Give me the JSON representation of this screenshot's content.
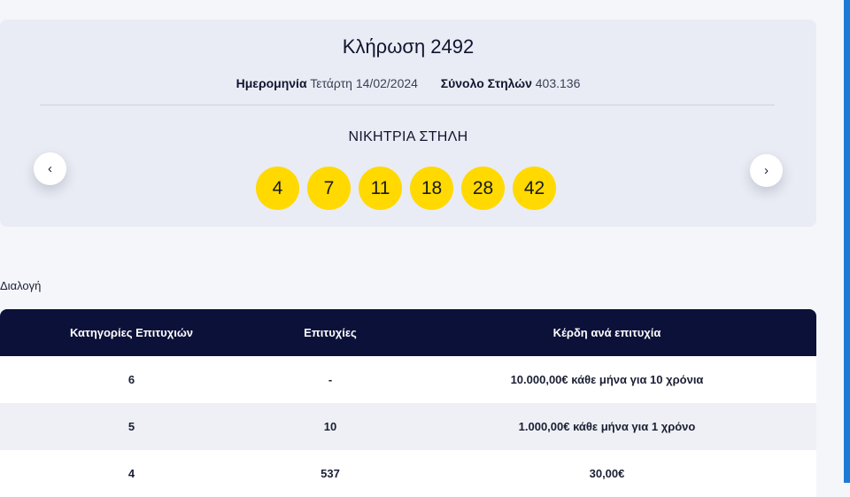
{
  "draw": {
    "title": "Κλήρωση 2492",
    "date_label": "Ημερομηνία",
    "date_value": "Τετάρτη 14/02/2024",
    "total_label": "Σύνολο Στηλών",
    "total_value": "403.136",
    "winning_label": "ΝΙΚΗΤΡΙΑ ΣΤΗΛΗ",
    "numbers": [
      "4",
      "7",
      "11",
      "18",
      "28",
      "42"
    ],
    "ball_color": "#ffd900"
  },
  "nav": {
    "prev_icon": "chevron-left-icon",
    "next_icon": "chevron-right-icon",
    "prev_glyph": "‹",
    "next_glyph": "›"
  },
  "section": {
    "label": "Διαλογή"
  },
  "table": {
    "headers": [
      "Κατηγορίες Επιτυχιών",
      "Επιτυχίες",
      "Κέρδη ανά επιτυχία"
    ],
    "header_color": "#0b1138",
    "rows": [
      [
        "6",
        "-",
        "10.000,00€ κάθε μήνα για 10 χρόνια"
      ],
      [
        "5",
        "10",
        "1.000,00€ κάθε μήνα για 1 χρόνο"
      ],
      [
        "4",
        "537",
        "30,00€"
      ]
    ]
  },
  "accent": "#1d7bd6"
}
